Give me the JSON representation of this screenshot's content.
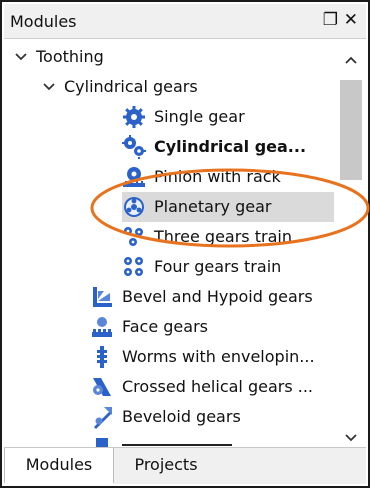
{
  "window": {
    "title": "Modules",
    "float_icon": "❐",
    "close_icon": "✕"
  },
  "tree": {
    "items": [
      {
        "label": "Toothing",
        "icon": "chevron-down-icon",
        "level": 0,
        "expanded": true
      },
      {
        "label": "Cylindrical gears",
        "icon": "chevron-down-icon",
        "level": 1,
        "expanded": true
      },
      {
        "label": "Single gear",
        "icon": "single-gear-icon",
        "level": 2
      },
      {
        "label": "Cylindrical gea...",
        "icon": "cylindrical-gear-pair-icon",
        "level": 2,
        "bold": true
      },
      {
        "label": "Pinion with rack",
        "icon": "pinion-rack-icon",
        "level": 2
      },
      {
        "label": "Planetary gear",
        "icon": "planetary-gear-icon",
        "level": 2,
        "selected": true
      },
      {
        "label": "Three gears train",
        "icon": "three-gears-icon",
        "level": 2
      },
      {
        "label": "Four gears train",
        "icon": "four-gears-icon",
        "level": 2
      },
      {
        "label": "Bevel and Hypoid gears",
        "icon": "bevel-gear-icon",
        "level": 1
      },
      {
        "label": "Face gears",
        "icon": "face-gear-icon",
        "level": 1
      },
      {
        "label": "Worms with envelopin...",
        "icon": "worm-gear-icon",
        "level": 1
      },
      {
        "label": "Crossed helical gears ...",
        "icon": "crossed-helical-gear-icon",
        "level": 1
      },
      {
        "label": "Beveloid gears",
        "icon": "beveloid-gear-icon",
        "level": 1
      }
    ]
  },
  "tabs": [
    {
      "label": "Modules",
      "active": true
    },
    {
      "label": "Projects",
      "active": false
    }
  ],
  "colors": {
    "annotation": "#e8731e",
    "icon_blue": "#2a62c9",
    "selection": "#dadada"
  }
}
